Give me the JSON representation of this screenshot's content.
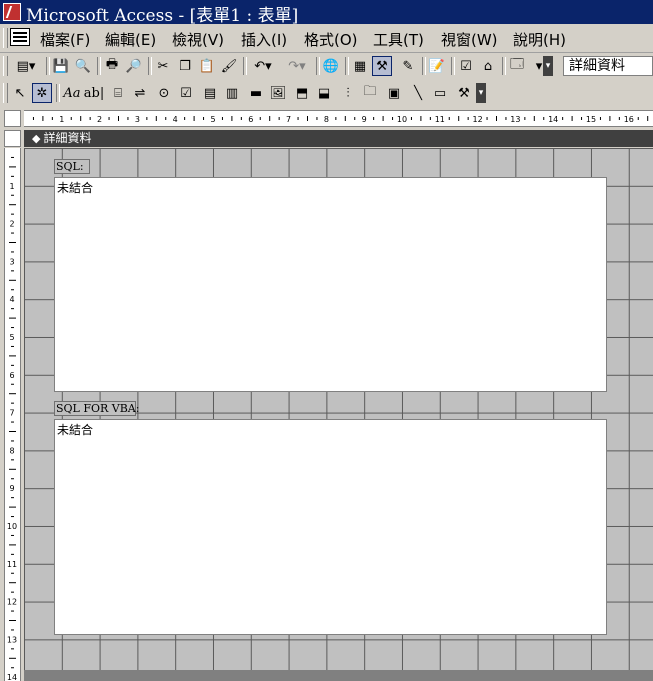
{
  "window": {
    "title": "Microsoft Access - [表單1 : 表單]"
  },
  "menubar": {
    "items": [
      {
        "label": "檔案(F)"
      },
      {
        "label": "編輯(E)"
      },
      {
        "label": "檢視(V)"
      },
      {
        "label": "插入(I)"
      },
      {
        "label": "格式(O)"
      },
      {
        "label": "工具(T)"
      },
      {
        "label": "視窗(W)"
      },
      {
        "label": "說明(H)"
      }
    ]
  },
  "toolbar": {
    "section_selector_value": "詳細資料"
  },
  "hruler": {
    "labels": [
      "1",
      "2",
      "3",
      "4",
      "5",
      "6",
      "7",
      "8",
      "9",
      "10",
      "11",
      "12",
      "13",
      "14",
      "15",
      "16"
    ]
  },
  "vruler": {
    "labels": [
      "1",
      "2",
      "3",
      "4",
      "5",
      "6",
      "7",
      "8",
      "9",
      "10",
      "11",
      "12",
      "13",
      "14"
    ]
  },
  "design": {
    "section_title": "詳細資料",
    "label1": "SQL:",
    "textbox1_value": "未結合",
    "label2": "SQL FOR VBA:",
    "textbox2_value": "未結合"
  },
  "icons": {
    "tb1": [
      "view-icon",
      "save-icon",
      "search-file-icon",
      "print-icon",
      "print-preview-icon",
      "cut-icon",
      "copy-icon",
      "paste-icon",
      "format-painter-icon",
      "undo-icon",
      "redo-icon",
      "hyperlink-icon",
      "field-list-icon",
      "toolbox-icon",
      "autoformat-icon",
      "code-icon",
      "properties-icon",
      "build-icon",
      "database-window-icon",
      "new-object-icon"
    ],
    "tb2": [
      "select-objects-icon",
      "control-wizards-icon",
      "label-icon",
      "textbox-icon",
      "option-group-icon",
      "toggle-button-icon",
      "option-button-icon",
      "checkbox-icon",
      "combobox-icon",
      "listbox-icon",
      "command-button-icon",
      "image-icon",
      "unbound-object-icon",
      "bound-object-icon",
      "page-break-icon",
      "tab-control-icon",
      "subform-icon",
      "line-icon",
      "rectangle-icon",
      "more-controls-icon"
    ]
  }
}
